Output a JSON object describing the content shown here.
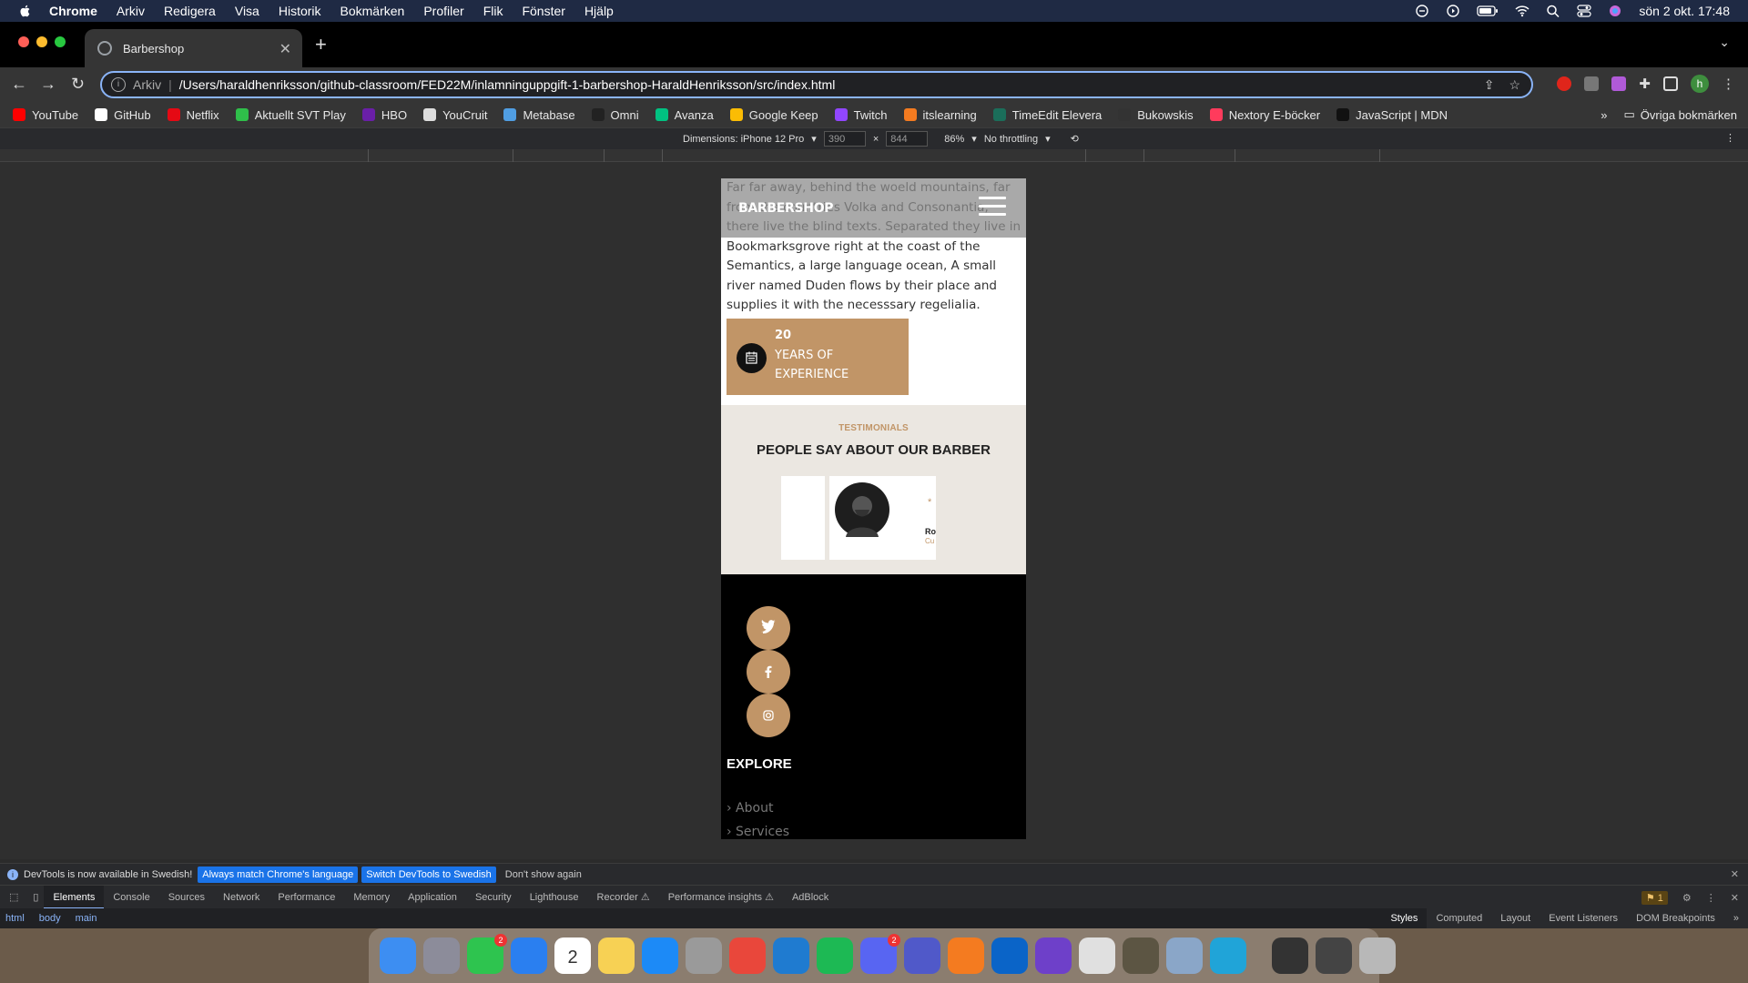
{
  "menubar": {
    "app_name": "Chrome",
    "items": [
      "Arkiv",
      "Redigera",
      "Visa",
      "Historik",
      "Bokmärken",
      "Profiler",
      "Flik",
      "Fönster",
      "Hjälp"
    ],
    "clock": "sön 2 okt. 17:48"
  },
  "browser": {
    "tab_title": "Barbershop",
    "address_scheme": "Arkiv",
    "address_url": "/Users/haraldhenriksson/github-classroom/FED22M/inlamninguppgift-1-barbershop-HaraldHenriksson/src/index.html",
    "profile_initial": "h"
  },
  "bookmarks": {
    "items": [
      {
        "label": "YouTube",
        "color": "#ff0000"
      },
      {
        "label": "GitHub",
        "color": "#ffffff"
      },
      {
        "label": "Netflix",
        "color": "#e50914"
      },
      {
        "label": "Aktuellt SVT Play",
        "color": "#2fbf4a"
      },
      {
        "label": "HBO",
        "color": "#6a1fa8"
      },
      {
        "label": "YouCruit",
        "color": "#dddddd"
      },
      {
        "label": "Metabase",
        "color": "#509ee3"
      },
      {
        "label": "Omni",
        "color": "#222222"
      },
      {
        "label": "Avanza",
        "color": "#00c281"
      },
      {
        "label": "Google Keep",
        "color": "#fbbc04"
      },
      {
        "label": "Twitch",
        "color": "#9146ff"
      },
      {
        "label": "itslearning",
        "color": "#f47b20"
      },
      {
        "label": "TimeEdit Elevera",
        "color": "#1b6e5a"
      },
      {
        "label": "Bukowskis",
        "color": "#333333"
      },
      {
        "label": "Nextory E-böcker",
        "color": "#ff3b5c"
      },
      {
        "label": "JavaScript | MDN",
        "color": "#111111"
      }
    ],
    "more": "»",
    "other": "Övriga bokmärken"
  },
  "device_toolbar": {
    "dimensions_label": "Dimensions: iPhone 12 Pro",
    "width": "390",
    "height": "844",
    "times": "×",
    "zoom": "86%",
    "throttling": "No throttling"
  },
  "site": {
    "logo": "BARBERSHOP",
    "about_text": "Far far away, behind the woeld mountains, far from the countries Volka and Consonantia, there live the blind texts. Separated they live in Bookmarksgrove right at the coast of the Semantics, a large language ocean, A small river named Duden flows by their place and supplies it with the necesssary regelialia.",
    "experience_number": "20",
    "experience_label": "YEARS OF EXPERIENCE",
    "testimonials_eyebrow": "TESTIMONIALS",
    "testimonials_heading": "PEOPLE SAY ABOUT OUR BARBER",
    "testimonial_star": "*",
    "testimonial_name": "Ro",
    "testimonial_role": "Cu",
    "explore_title": "EXPLORE",
    "explore_links": [
      "› About",
      "› Services"
    ],
    "social": [
      "twitter-icon",
      "facebook-icon",
      "instagram-icon"
    ],
    "accent_color": "#c19567"
  },
  "devtools": {
    "notice": "DevTools is now available in Swedish!",
    "btn_match": "Always match Chrome's language",
    "btn_switch": "Switch DevTools to Swedish",
    "dont_show": "Don't show again",
    "tabs": [
      "Elements",
      "Console",
      "Sources",
      "Network",
      "Performance",
      "Memory",
      "Application",
      "Security",
      "Lighthouse",
      "Recorder ⚠",
      "Performance insights ⚠",
      "AdBlock"
    ],
    "issues_count": "1",
    "breadcrumbs": [
      "html",
      "body",
      "main"
    ],
    "subtabs": [
      "Styles",
      "Computed",
      "Layout",
      "Event Listeners",
      "DOM Breakpoints",
      "»"
    ]
  },
  "dock": {
    "apps": [
      {
        "name": "finder",
        "color": "#3d8ef2"
      },
      {
        "name": "launchpad",
        "color": "#8c8c9a"
      },
      {
        "name": "messages",
        "color": "#2ec44f",
        "badge": "2"
      },
      {
        "name": "mail",
        "color": "#2a7ff0"
      },
      {
        "name": "calendar",
        "color": "#ffffff",
        "label": "2"
      },
      {
        "name": "notes",
        "color": "#f7d154"
      },
      {
        "name": "app-store",
        "color": "#1c8af7"
      },
      {
        "name": "system-preferences",
        "color": "#9a9a9a"
      },
      {
        "name": "chrome",
        "color": "#e9473b"
      },
      {
        "name": "vscode",
        "color": "#1f7bd0"
      },
      {
        "name": "spotify",
        "color": "#1db954"
      },
      {
        "name": "discord",
        "color": "#5865f2",
        "badge": "2"
      },
      {
        "name": "teams",
        "color": "#5059c9"
      },
      {
        "name": "itslearning",
        "color": "#f47b20"
      },
      {
        "name": "outlook",
        "color": "#0a64c8"
      },
      {
        "name": "github-desktop",
        "color": "#6e40c9"
      },
      {
        "name": "tableplus",
        "color": "#e0e0e0"
      },
      {
        "name": "gimp",
        "color": "#5c5543"
      },
      {
        "name": "preview",
        "color": "#8aa6c8"
      },
      {
        "name": "edge",
        "color": "#20a4d8"
      }
    ],
    "extras": [
      {
        "name": "activity-monitor",
        "color": "#333333"
      },
      {
        "name": "photo-folder",
        "color": "#444444"
      },
      {
        "name": "trash",
        "color": "#b8b8b8"
      }
    ]
  }
}
